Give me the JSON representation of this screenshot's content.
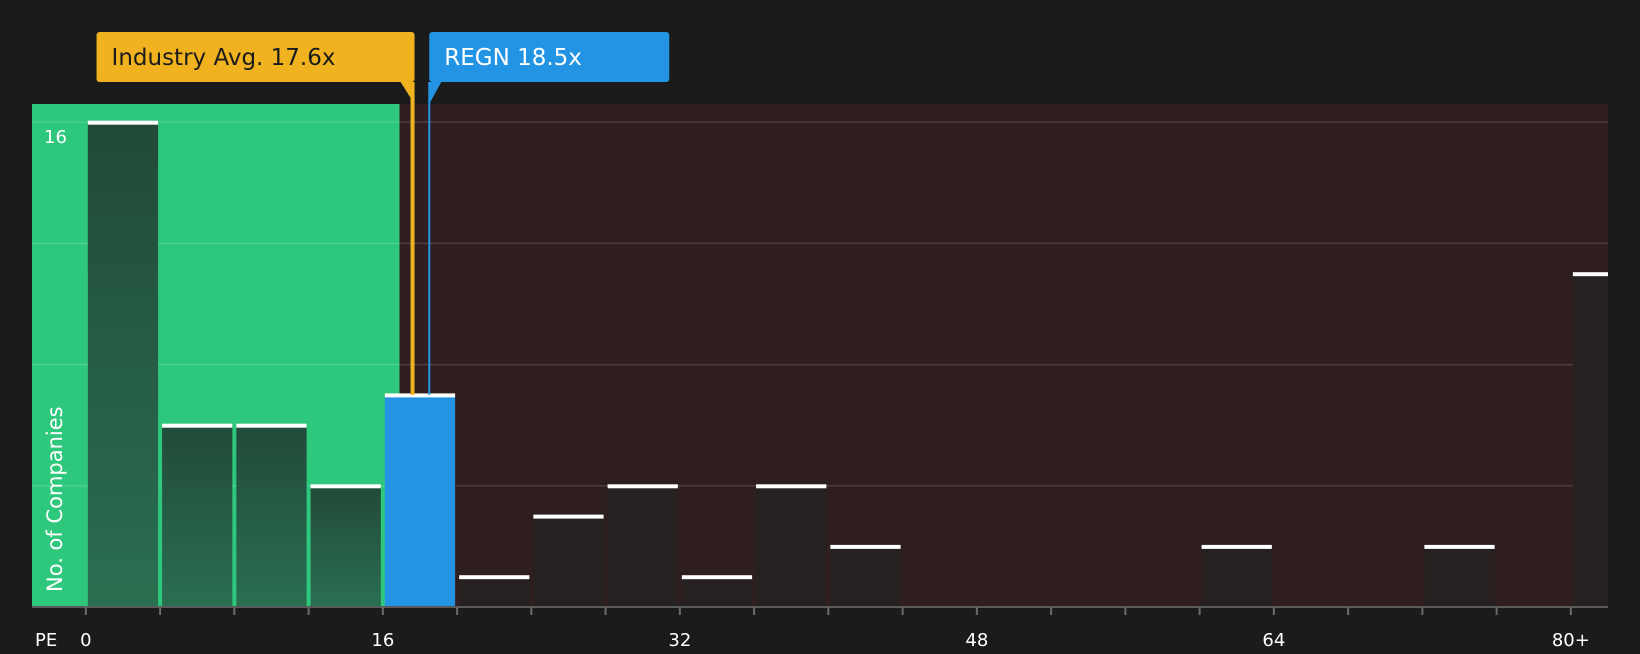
{
  "chart_data": {
    "type": "bar",
    "title": "",
    "xlabel": "PE",
    "ylabel": "No. of Companies",
    "x_ticks": [
      {
        "value": 0,
        "label": "0"
      },
      {
        "value": 16,
        "label": "16"
      },
      {
        "value": 32,
        "label": "32"
      },
      {
        "value": 48,
        "label": "48"
      },
      {
        "value": 64,
        "label": "64"
      },
      {
        "value": 80,
        "label": "80+"
      }
    ],
    "y_ticks": [
      {
        "value": 16,
        "label": "16"
      }
    ],
    "xlim": [
      -2.9,
      82
    ],
    "ylim": [
      0,
      16.6
    ],
    "bin_width": 4,
    "bins": [
      {
        "x0": 0,
        "x1": 4,
        "count": 16
      },
      {
        "x0": 4,
        "x1": 8,
        "count": 6
      },
      {
        "x0": 8,
        "x1": 12,
        "count": 6
      },
      {
        "x0": 12,
        "x1": 16,
        "count": 4
      },
      {
        "x0": 16,
        "x1": 20,
        "count": 7,
        "highlight": true
      },
      {
        "x0": 20,
        "x1": 24,
        "count": 1
      },
      {
        "x0": 24,
        "x1": 28,
        "count": 3
      },
      {
        "x0": 28,
        "x1": 32,
        "count": 4
      },
      {
        "x0": 32,
        "x1": 36,
        "count": 1
      },
      {
        "x0": 36,
        "x1": 40,
        "count": 4
      },
      {
        "x0": 40,
        "x1": 44,
        "count": 2
      },
      {
        "x0": 44,
        "x1": 48,
        "count": 0
      },
      {
        "x0": 48,
        "x1": 52,
        "count": 0
      },
      {
        "x0": 52,
        "x1": 56,
        "count": 0
      },
      {
        "x0": 56,
        "x1": 60,
        "count": 0
      },
      {
        "x0": 60,
        "x1": 64,
        "count": 2
      },
      {
        "x0": 64,
        "x1": 68,
        "count": 0
      },
      {
        "x0": 68,
        "x1": 72,
        "count": 0
      },
      {
        "x0": 72,
        "x1": 76,
        "count": 2
      },
      {
        "x0": 76,
        "x1": 80,
        "count": 0
      },
      {
        "x0": 80,
        "x1": 84,
        "count": 11
      }
    ],
    "green_zone_max": 16.9,
    "grid": true,
    "markers": [
      {
        "name": "industry-avg",
        "label": "Industry Avg. 17.6x",
        "value": 17.6,
        "color": "#f0b21e"
      },
      {
        "name": "regn",
        "label": "REGN 18.5x",
        "value": 18.5,
        "color": "#2394e3"
      }
    ],
    "colors": {
      "background": "#1b1b1b",
      "green_zone": "#2ec87d",
      "red_zone": "#2f1e1f",
      "bar_in_green": "#245240",
      "bar_in_red": "#262020",
      "highlight_bar": "#2394e3",
      "bar_cap": "#ffffff",
      "grid": "#ffffff",
      "text": "#ffffff"
    }
  }
}
